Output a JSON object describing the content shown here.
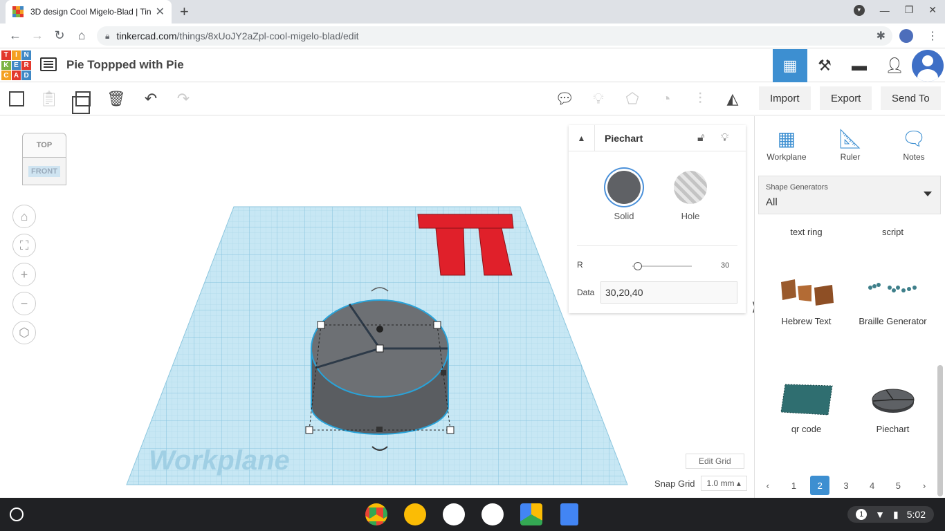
{
  "browser": {
    "tab_title": "3D design Cool Migelo-Blad | Tin",
    "url_host": "tinkercad.com",
    "url_path": "/things/8xUoJY2aZpl-cool-migelo-blad/edit"
  },
  "app": {
    "logo_letters": [
      "TIN",
      "KER",
      "CAD"
    ],
    "design_title": "Pie Toppped with Pie"
  },
  "actions": {
    "import": "Import",
    "export": "Export",
    "send_to": "Send To"
  },
  "viewcube": {
    "top": "TOP",
    "front": "FRONT"
  },
  "workplane": {
    "label": "Workplane",
    "edit_grid": "Edit Grid",
    "snap_label": "Snap Grid",
    "snap_value": "1.0 mm ▴"
  },
  "inspector": {
    "title": "Piechart",
    "solid": "Solid",
    "hole": "Hole",
    "r_label": "R",
    "r_value": "30",
    "data_label": "Data",
    "data_value": "30,20,40"
  },
  "right_panel": {
    "tools": [
      "Workplane",
      "Ruler",
      "Notes"
    ],
    "generator_label": "Shape Generators",
    "generator_value": "All",
    "items": [
      {
        "label": "text ring"
      },
      {
        "label": "script"
      },
      {
        "label": "Hebrew Text"
      },
      {
        "label": "Braille Generator"
      },
      {
        "label": "qr code"
      },
      {
        "label": "Piechart"
      }
    ],
    "pages": [
      "1",
      "2",
      "3",
      "4",
      "5"
    ],
    "active_page": "2"
  },
  "shelf": {
    "time": "5:02",
    "notif_count": "1"
  },
  "colors": {
    "accent": "#3d8fd1",
    "shape_red": "#e0202a",
    "pie_gray": "#6a6d70",
    "grid_blue": "#bfe3f2"
  }
}
